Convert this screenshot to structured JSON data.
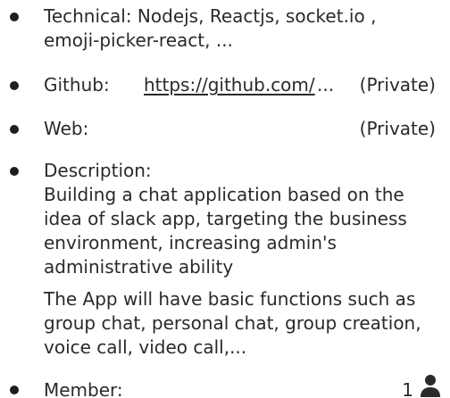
{
  "technical": {
    "line1": "Technical: Nodejs, Reactjs, socket.io ,",
    "line2": "emoji-picker-react, ..."
  },
  "github": {
    "label": "Github:",
    "url_text": "https://github.com/",
    "ellipsis": "...",
    "status": "(Private)"
  },
  "web": {
    "label": "Web:",
    "status": "(Private)"
  },
  "description": {
    "label": "Description:",
    "paragraph1": [
      "Building a chat application based on the",
      "idea of slack app, targeting the business",
      "environment, increasing admin's",
      "administrative ability"
    ],
    "paragraph2": [
      "The App will have basic functions such as",
      "group chat, personal chat, group creation,",
      "voice call, video call,..."
    ]
  },
  "member": {
    "label": "Member:",
    "count": "1",
    "icon": "person-icon"
  }
}
